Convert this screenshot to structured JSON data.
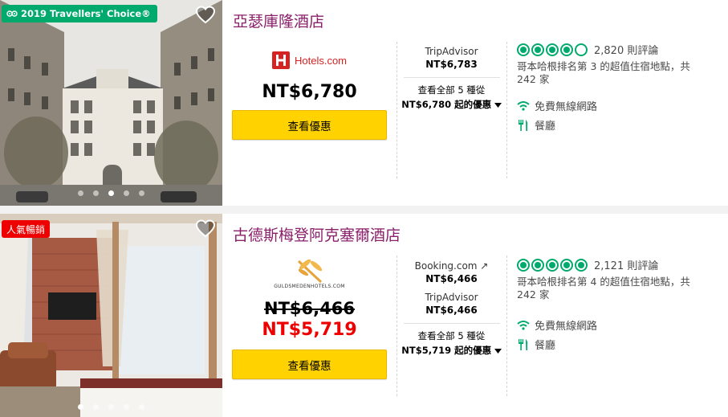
{
  "hotels": [
    {
      "badge": "2019 Travellers' Choice®",
      "name": "亞瑟庫隆酒店",
      "main_provider_logo": "Hotels.com",
      "main_price": "NT$6,780",
      "deal_button": "查看優惠",
      "offers": [
        {
          "provider": "TripAdvisor",
          "price": "NT$6,783"
        }
      ],
      "all_offers_line1": "查看全部 5 種從",
      "all_offers_line2": "NT$6,780 起的優惠",
      "rating_bubbles": 4,
      "review_count": "2,820 則評論",
      "rank_text": "哥本哈根排名第 3 的超值住宿地點，共 242 家",
      "amenities": [
        "免費無線網路",
        "餐廳"
      ],
      "photo_dots": 5,
      "active_dot": 2
    },
    {
      "badge": "人氣暢銷",
      "name": "古德斯梅登阿克塞爾酒店",
      "main_provider_logo": "GULDSMEDENHOTELS.COM",
      "original_price": "NT$6,466",
      "sale_price": "NT$5,719",
      "deal_button": "查看優惠",
      "offers": [
        {
          "provider": "Booking.com ↗",
          "price": "NT$6,466"
        },
        {
          "provider": "TripAdvisor",
          "price": "NT$6,466"
        }
      ],
      "all_offers_line1": "查看全部 5 種從",
      "all_offers_line2": "NT$5,719 起的優惠",
      "rating_bubbles": 5,
      "review_count": "2,121 則評論",
      "rank_text": "哥本哈根排名第 4 的超值住宿地點，共 242 家",
      "amenities": [
        "免費無線網路",
        "餐廳"
      ],
      "photo_dots": 5,
      "active_dot": 0
    }
  ],
  "colors": {
    "title": "#8a1f6a",
    "badge_tc": "#00aa6c",
    "badge_popular": "#ee0000",
    "deal_button": "#ffd200",
    "sale_price": "#ee0000",
    "rating": "#00aa6c"
  },
  "icons": {
    "favorite": "heart-icon",
    "wifi": "wifi-icon",
    "restaurant": "fork-knife-icon",
    "dropdown": "caret-down-icon",
    "badge": "owl-icon"
  }
}
